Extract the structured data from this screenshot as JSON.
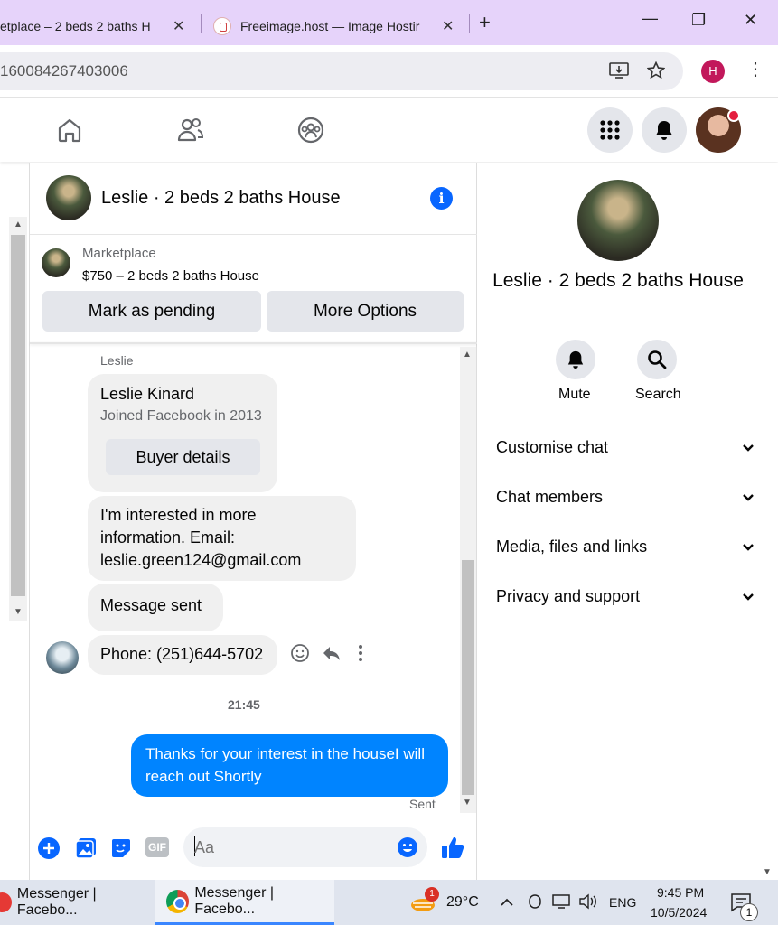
{
  "browser": {
    "tabs": [
      {
        "title": "etplace – 2 beds 2 baths H",
        "close": "✕"
      },
      {
        "title": "Freeimage.host — Image Hostir",
        "close": "✕"
      }
    ],
    "new_tab": "+",
    "window_controls": {
      "minimize": "—",
      "restore": "❐",
      "close": "✕"
    },
    "url": "160084267403006",
    "profile_initial": "H",
    "menu": "⋮"
  },
  "fbnav": {
    "icons": [
      "home-icon",
      "friends-icon",
      "groups-icon",
      "menu-grid-icon",
      "bell-icon"
    ]
  },
  "chat": {
    "title": "Leslie · 2 beds 2 baths House",
    "info_icon": "i",
    "marketplace": {
      "label": "Marketplace",
      "listing": "$750 – 2 beds 2 baths House",
      "buttons": {
        "pending": "Mark as pending",
        "options": "More Options"
      }
    },
    "sender": "Leslie",
    "profile_card": {
      "name": "Leslie Kinard",
      "joined": "Joined Facebook in 2013",
      "button": "Buyer details"
    },
    "messages": [
      {
        "text": "I'm interested in more information. Email: leslie.green124@gmail.com"
      },
      {
        "text": "Message sent"
      },
      {
        "text": "Phone: (251)644-5702"
      }
    ],
    "timestamp": "21:45",
    "my_message": "Thanks for your interest in the houseI will reach out Shortly",
    "status": "Sent",
    "composer": {
      "placeholder": "Aa",
      "gif": "GIF"
    }
  },
  "details": {
    "title": "Leslie · 2 beds 2 baths House",
    "actions": [
      {
        "label": "Mute"
      },
      {
        "label": "Search"
      }
    ],
    "sections": [
      {
        "label": "Customise chat"
      },
      {
        "label": "Chat members"
      },
      {
        "label": "Media, files and links"
      },
      {
        "label": "Privacy and support"
      }
    ]
  },
  "taskbar": {
    "items": [
      {
        "label": "Messenger | Facebo..."
      },
      {
        "label": "Messenger | Facebo..."
      }
    ],
    "weather": "29°C",
    "weather_badge": "1",
    "lang": "ENG",
    "time": "9:45 PM",
    "date": "10/5/2024",
    "notifications": "1"
  },
  "colors": {
    "accent": "#0866ff",
    "my_bubble": "#0084ff",
    "tab_strip": "#e6d3fa"
  }
}
